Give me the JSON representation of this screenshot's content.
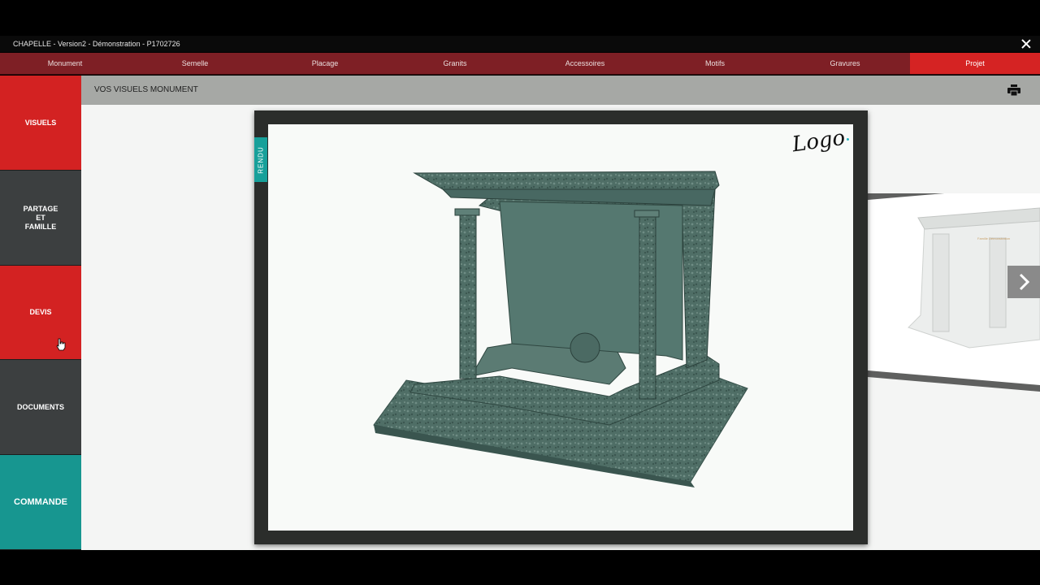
{
  "window": {
    "title": "CHAPELLE - Version2 - Démonstration - P1702726"
  },
  "tabs": [
    {
      "label": "Monument"
    },
    {
      "label": "Semelle"
    },
    {
      "label": "Placage"
    },
    {
      "label": "Granits"
    },
    {
      "label": "Accessoires"
    },
    {
      "label": "Motifs"
    },
    {
      "label": "Gravures"
    },
    {
      "label": "Projet"
    }
  ],
  "sidebar": {
    "items": [
      {
        "label": "VISUELS"
      },
      {
        "label": "PARTAGE\nET\nFAMILLE"
      },
      {
        "label": "DEVIS"
      },
      {
        "label": "DOCUMENTS"
      },
      {
        "label": "COMMANDE"
      }
    ]
  },
  "main": {
    "header_title": "VOS VISUELS MONUMENT",
    "rendu_tab": "RENDU",
    "logo_text": "Logo"
  },
  "colors": {
    "tab_bar": "#7e1f25",
    "tab_active": "#d52323",
    "side_red": "#d32222",
    "side_dark": "#3c3f40",
    "side_teal": "#179690",
    "granite": "#4f6e66"
  }
}
